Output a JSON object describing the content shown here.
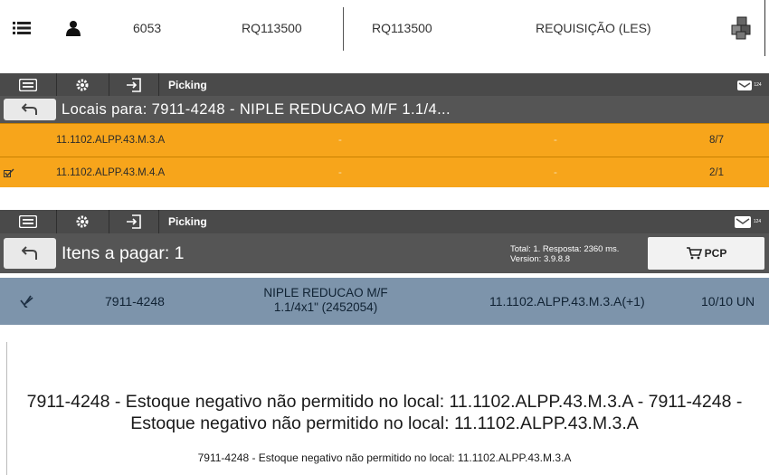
{
  "header": {
    "menu_icon": "list-menu-icon",
    "user_icon": "user-icon",
    "code": "6053",
    "req1": "RQ113500",
    "req2": "RQ113500",
    "req_type": "REQUISIÇÃO (LES)",
    "boxes_icon": "boxes-icon"
  },
  "panel1": {
    "toolbar": {
      "title": "Picking",
      "badge": "124"
    },
    "heading": "Locais para: 7911-4248 - NIPLE REDUCAO M/F 1.1/4...",
    "locations": [
      {
        "checked": false,
        "location": "11.1102.ALPP.43.M.3.A",
        "col2": "-",
        "col3": "-",
        "qty": "8/7"
      },
      {
        "checked": true,
        "location": "11.1102.ALPP.43.M.4.A",
        "col2": "-",
        "col3": "-",
        "qty": "2/1"
      }
    ]
  },
  "panel2": {
    "toolbar": {
      "title": "Picking",
      "badge": "124"
    },
    "heading": "Itens a pagar: 1",
    "status_line1": "Total: 1. Resposta: 2360 ms.",
    "status_line2": "Version: 3.9.8.8",
    "pcp_label": "PCP",
    "item": {
      "code": "7911-4248",
      "desc_line1": "NIPLE REDUCAO M/F",
      "desc_line2": "1.1/4x1\" (2452054)",
      "location": "11.1102.ALPP.43.M.3.A(+1)",
      "qty": "10/10 UN"
    }
  },
  "messages": {
    "error_big": "7911-4248 - Estoque negativo não permitido no local: 11.1102.ALPP.43.M.3.A - 7911-4248 - Estoque negativo não permitido no local: 11.1102.ALPP.43.M.3.A",
    "error_small": "7911-4248 - Estoque negativo não permitido no local: 11.1102.ALPP.43.M.3.A"
  },
  "colors": {
    "orange": "#f7a51b",
    "toolbar": "#4a4a4a",
    "item_row": "#7d94ab"
  }
}
